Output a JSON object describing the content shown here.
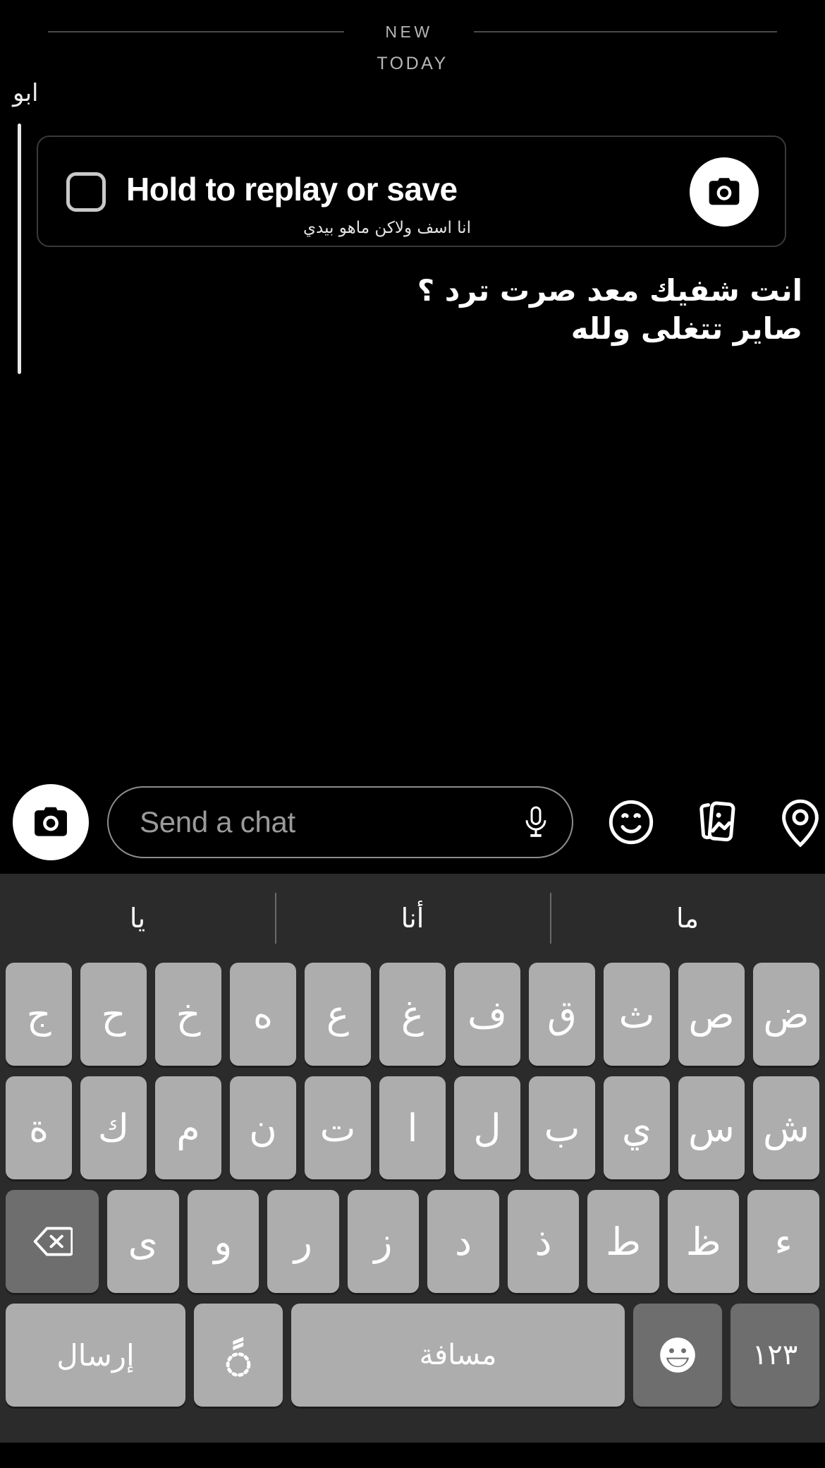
{
  "conversation": {
    "new_divider_label": "NEW",
    "today_label": "TODAY",
    "sender_name": "ابو",
    "snap_card": {
      "title": "Hold to replay or save",
      "subtitle": "انا اسف ولاكن ماهو بيدي",
      "camera_icon": "camera-icon",
      "status_icon": "snap-opened-square-icon"
    },
    "outgoing_messages": [
      "انت شفيك معد صرت ترد ؟",
      "صاير تتغلى ولله"
    ]
  },
  "chat_bar": {
    "camera_icon": "camera-icon",
    "input_placeholder": "Send a chat",
    "input_value": "",
    "mic_icon": "microphone-icon",
    "smiley_icon": "smiley-sticker-icon",
    "sticker_icon": "photo-cards-icon",
    "location_icon": "location-pin-icon"
  },
  "keyboard": {
    "suggestions": [
      "يا",
      "أنا",
      "ما"
    ],
    "row1": [
      "ض",
      "ص",
      "ث",
      "ق",
      "ف",
      "غ",
      "ع",
      "ه",
      "خ",
      "ح",
      "ج"
    ],
    "row2": [
      "ش",
      "س",
      "ي",
      "ب",
      "ل",
      "ا",
      "ت",
      "ن",
      "م",
      "ك",
      "ة"
    ],
    "row3": [
      "ء",
      "ظ",
      "ط",
      "ذ",
      "د",
      "ز",
      "ر",
      "و",
      "ى"
    ],
    "backspace_icon": "backspace-delete-icon",
    "numbers_key": "١٢٣",
    "emoji_icon": "emoji-face-icon",
    "space_key": "مسافة",
    "diacritics_icon": "arabic-diacritics-icon",
    "send_key": "إرسال"
  },
  "colors": {
    "background": "#000000",
    "keyboard_bg": "#2b2b2b",
    "key_light": "#adadad",
    "key_dark": "#6e6e6e",
    "divider": "#4a4a4a",
    "muted_text": "#b6b6b6",
    "placeholder": "#9a9a9a",
    "accent_white": "#ffffff"
  }
}
